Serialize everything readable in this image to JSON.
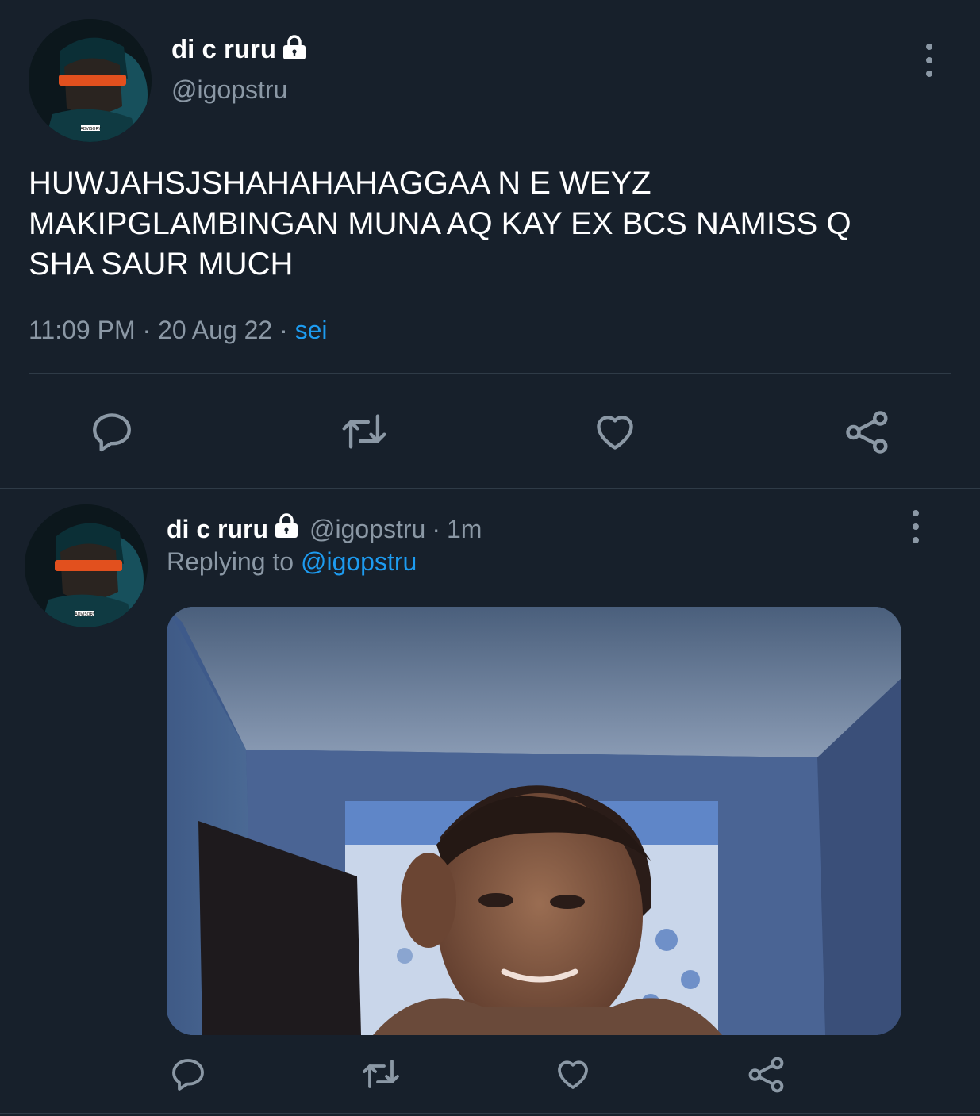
{
  "main_tweet": {
    "display_name": "di c ruru",
    "handle": "@igopstru",
    "text_lines": [
      "HUWJAHSJSHAHAHAHAGGAA N E WEYZ",
      "MAKIPGLAMBINGAN MUNA AQ KAY EX BCS NAMISS Q",
      "SHA SAUR MUCH"
    ],
    "time": "11:09 PM",
    "date": "20 Aug 22",
    "source": "sei",
    "separator": "·",
    "avatar_label": "ADVISORY"
  },
  "reply": {
    "display_name": "di c ruru",
    "handle": "@igopstru",
    "age": "1m",
    "separator": "·",
    "replying_to_label": "Replying to",
    "replying_to_handle": "@igopstru",
    "avatar_label": "ADVISORY"
  },
  "icons": {
    "reply": "reply-icon",
    "retweet": "retweet-icon",
    "like": "heart-icon",
    "share": "share-icon",
    "protected": "lock-icon",
    "more": "more-vertical-icon"
  },
  "colors": {
    "background": "#17202b",
    "text": "#ffffff",
    "muted": "#8b98a5",
    "accent": "#1d9bf0",
    "divider": "#2f3b47"
  }
}
